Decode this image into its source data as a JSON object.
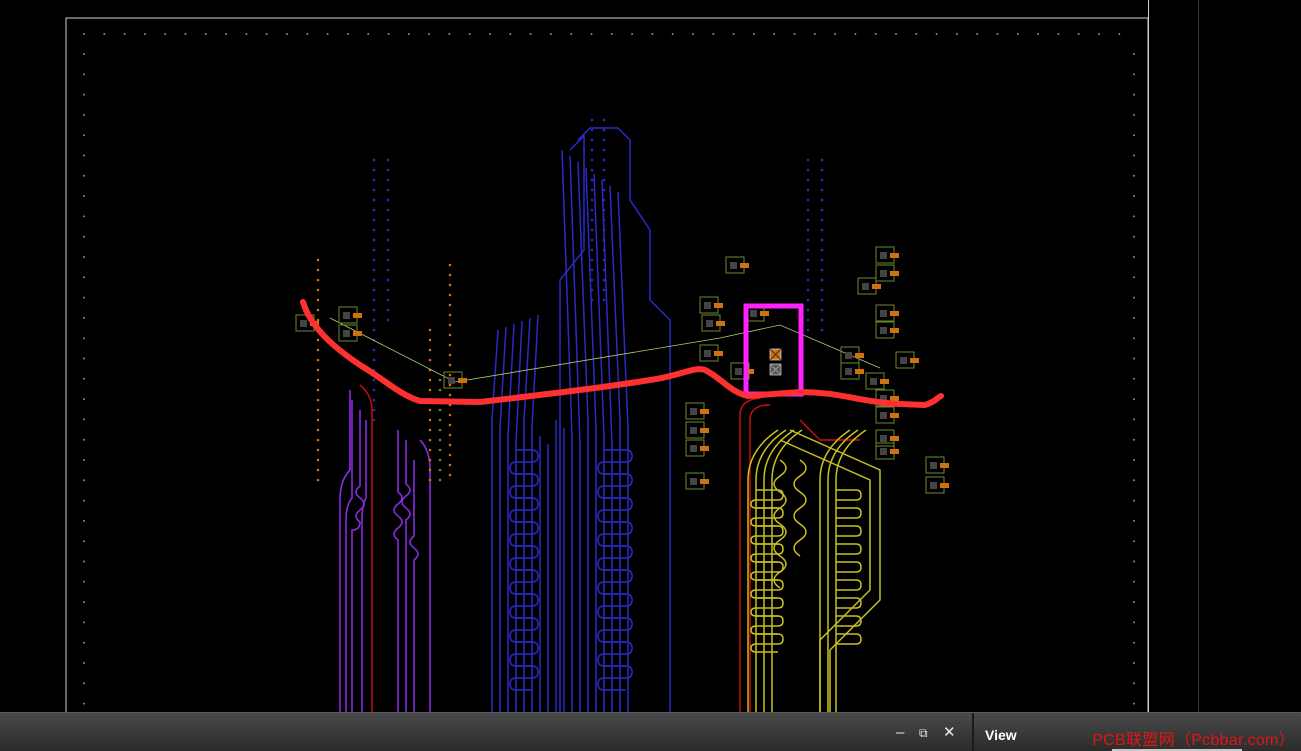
{
  "statusbar": {
    "minimize_glyph": "–",
    "restore_glyph": "⧉",
    "close_glyph": "✕",
    "view_label": "View",
    "watermark": "PCB联盟网（Pcbbar.com）"
  },
  "board": {
    "background": "#000000",
    "outline_color": "#cfcfcf",
    "annotation_line_color": "#ff3030",
    "highlight_box_color": "#ff22ff",
    "layer_colors": {
      "top_signal": "#2a2ac8",
      "purple_signal": "#8a2be2",
      "yellow_signal": "#c8c020",
      "red_signal": "#d01010",
      "components": "#d07010",
      "footprint_outline": "#6a8a30",
      "ratsnest": "#b4c878"
    }
  },
  "icons": [
    "minimize-icon",
    "restore-icon",
    "close-icon"
  ]
}
